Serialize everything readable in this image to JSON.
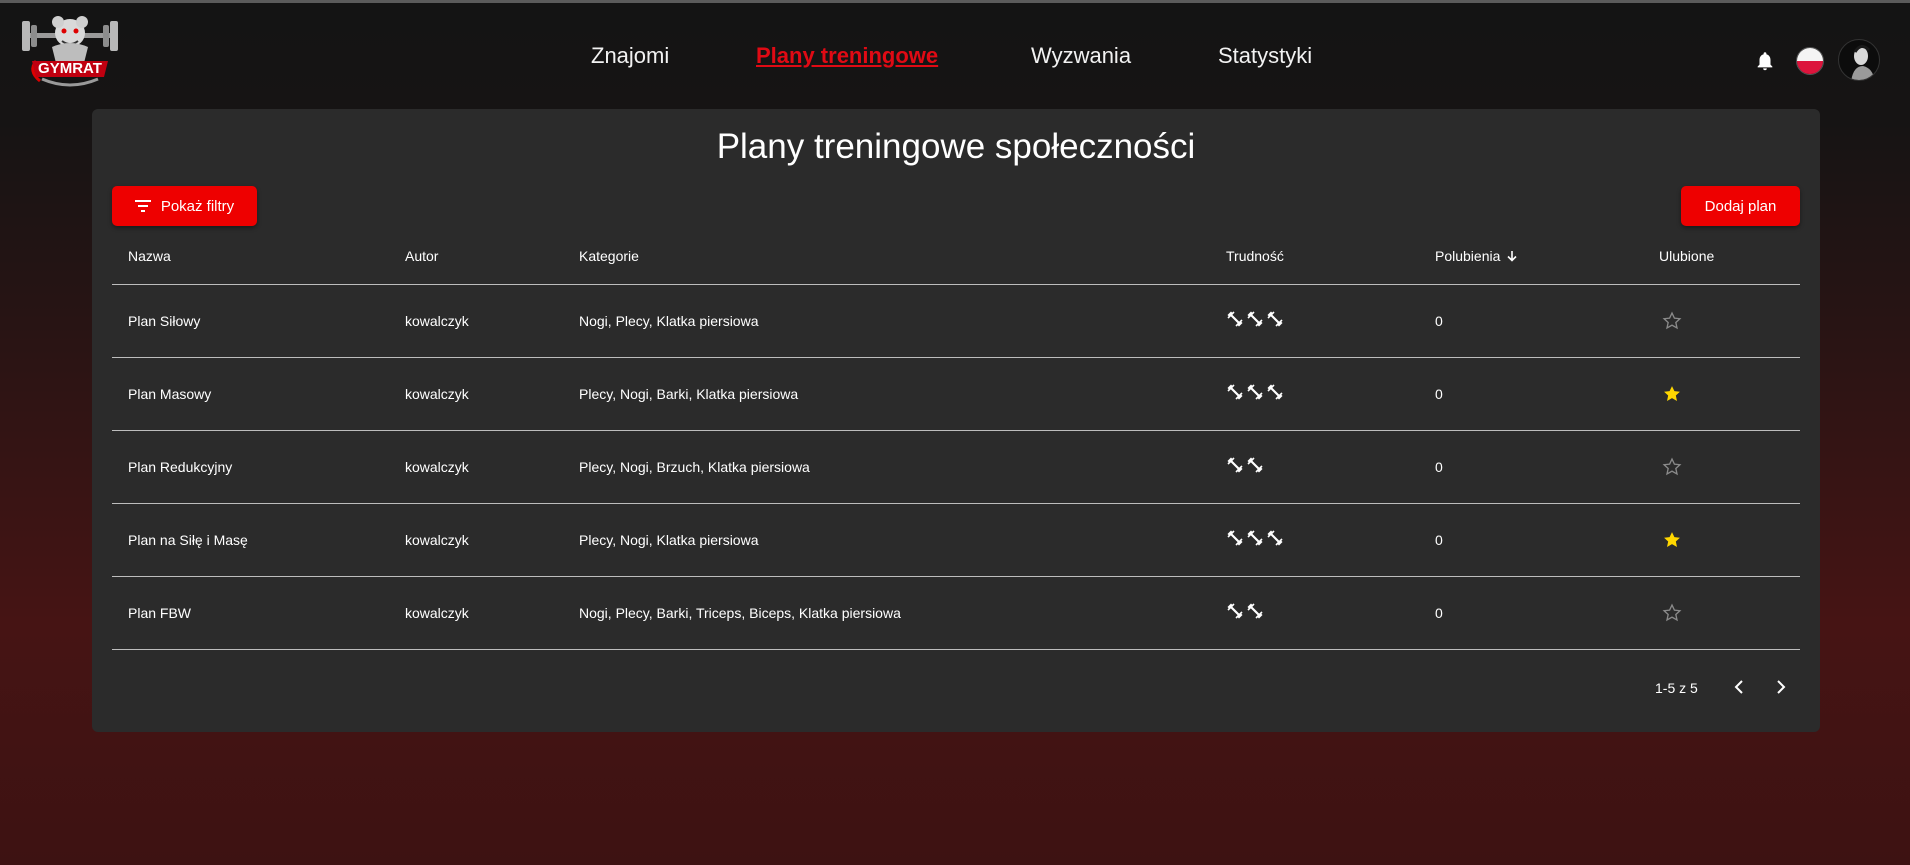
{
  "app": {
    "logo_text": "GYMRAT"
  },
  "nav": {
    "items": [
      {
        "label": "Znajomi",
        "active": false
      },
      {
        "label": "Plany treningowe",
        "active": true
      },
      {
        "label": "Wyzwania",
        "active": false
      },
      {
        "label": "Statystyki",
        "active": false
      }
    ]
  },
  "header_icons": {
    "notifications": "bell-icon",
    "language": "flag-pl-icon",
    "profile": "avatar"
  },
  "page": {
    "title": "Plany treningowe społeczności",
    "filters_button": "Pokaż filtry",
    "add_button": "Dodaj plan"
  },
  "table": {
    "columns": [
      "Nazwa",
      "Autor",
      "Kategorie",
      "Trudność",
      "Polubienia",
      "Ulubione"
    ],
    "sort": {
      "column": "Polubienia",
      "direction": "desc"
    },
    "rows": [
      {
        "name": "Plan Siłowy",
        "author": "kowalczyk",
        "categories": "Nogi, Plecy, Klatka piersiowa",
        "difficulty": 3,
        "likes": "0",
        "favorite": false
      },
      {
        "name": "Plan Masowy",
        "author": "kowalczyk",
        "categories": "Plecy, Nogi, Barki, Klatka piersiowa",
        "difficulty": 3,
        "likes": "0",
        "favorite": true
      },
      {
        "name": "Plan Redukcyjny",
        "author": "kowalczyk",
        "categories": "Plecy, Nogi, Brzuch, Klatka piersiowa",
        "difficulty": 2,
        "likes": "0",
        "favorite": false
      },
      {
        "name": "Plan na Siłę i Masę",
        "author": "kowalczyk",
        "categories": "Plecy, Nogi, Klatka piersiowa",
        "difficulty": 3,
        "likes": "0",
        "favorite": true
      },
      {
        "name": "Plan FBW",
        "author": "kowalczyk",
        "categories": "Nogi, Plecy, Barki, Triceps, Biceps, Klatka piersiowa",
        "difficulty": 2,
        "likes": "0",
        "favorite": false
      }
    ]
  },
  "pagination": {
    "range": "1-5 z 5"
  },
  "colors": {
    "accent": "#ee0000",
    "active_nav": "#e00a14",
    "card": "#2b2b2b",
    "star_on": "#ffd700",
    "star_off": "#8a8a8a"
  }
}
